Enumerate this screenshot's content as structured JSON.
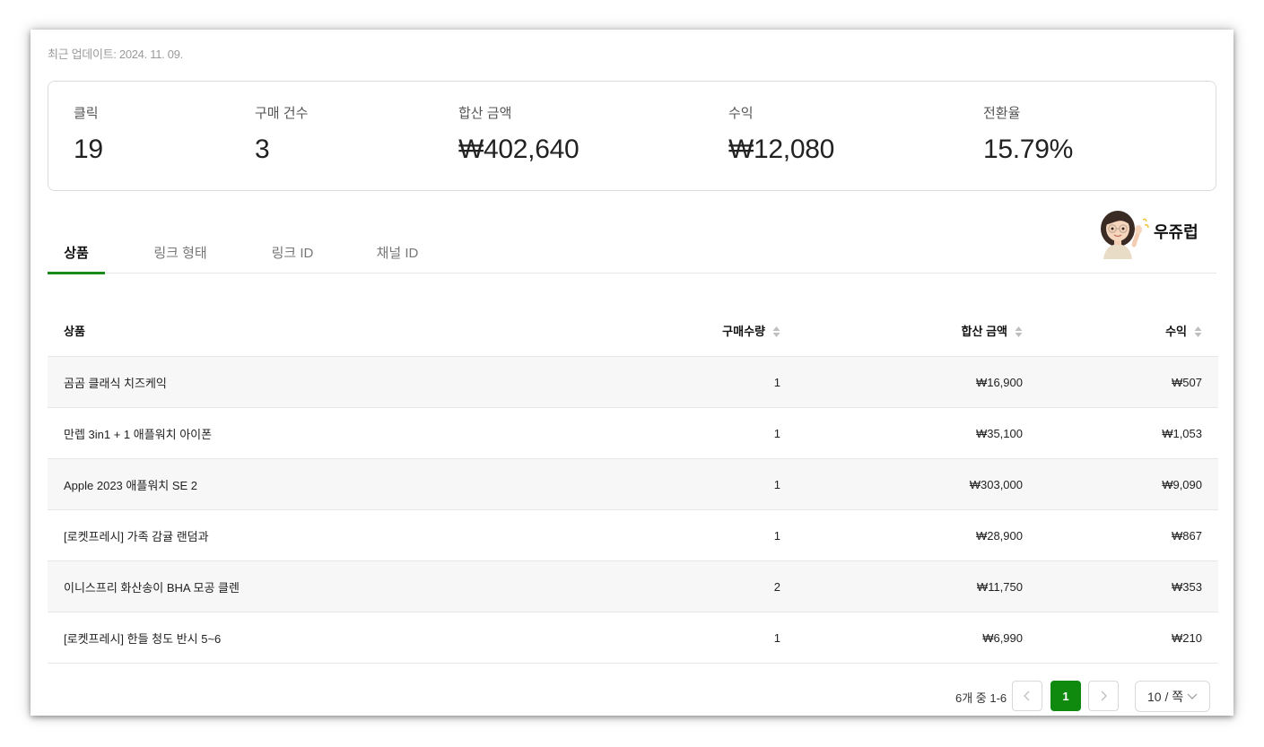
{
  "update": {
    "text": "최근 업데이트: 2024. 11. 09."
  },
  "stats": [
    {
      "label": "클릭",
      "value": "19"
    },
    {
      "label": "구매 건수",
      "value": "3"
    },
    {
      "label": "합산 금액",
      "value": "₩402,640"
    },
    {
      "label": "수익",
      "value": "₩12,080"
    },
    {
      "label": "전환율",
      "value": "15.79%"
    }
  ],
  "tabs": [
    {
      "label": "상품",
      "active": true
    },
    {
      "label": "링크 형태",
      "active": false
    },
    {
      "label": "링크 ID",
      "active": false
    },
    {
      "label": "채널 ID",
      "active": false
    }
  ],
  "brand": {
    "name": "우쥬럽",
    "avatar_icon": "memoji-waving-icon"
  },
  "table": {
    "columns": [
      {
        "label": "상품",
        "sortable": false
      },
      {
        "label": "구매수량",
        "sortable": true
      },
      {
        "label": "합산 금액",
        "sortable": true
      },
      {
        "label": "수익",
        "sortable": true
      }
    ],
    "rows": [
      {
        "product": "곰곰 클래식 치즈케익",
        "qty": "1",
        "total": "₩16,900",
        "profit": "₩507"
      },
      {
        "product": "만렙 3in1 + 1 애플워치 아이폰",
        "qty": "1",
        "total": "₩35,100",
        "profit": "₩1,053"
      },
      {
        "product": "Apple 2023 애플워치 SE 2",
        "qty": "1",
        "total": "₩303,000",
        "profit": "₩9,090"
      },
      {
        "product": "[로켓프레시] 가족 감귤 랜덤과",
        "qty": "1",
        "total": "₩28,900",
        "profit": "₩867"
      },
      {
        "product": "이니스프리 화산송이 BHA 모공 클렌",
        "qty": "2",
        "total": "₩11,750",
        "profit": "₩353"
      },
      {
        "product": "[로켓프레시] 한들 청도 반시 5~6",
        "qty": "1",
        "total": "₩6,990",
        "profit": "₩210"
      }
    ]
  },
  "pagination": {
    "summary": "6개 중 1-6",
    "prev_icon": "chevron-left-icon",
    "current_page": "1",
    "next_icon": "chevron-right-icon",
    "page_size": "10 / 쪽",
    "page_size_icon": "chevron-down-icon"
  },
  "colors": {
    "accent": "#0f8a0f",
    "tab_underline": "#1a8a1a",
    "row_alt": "#f7f7f7",
    "border": "#e6e6e6"
  }
}
